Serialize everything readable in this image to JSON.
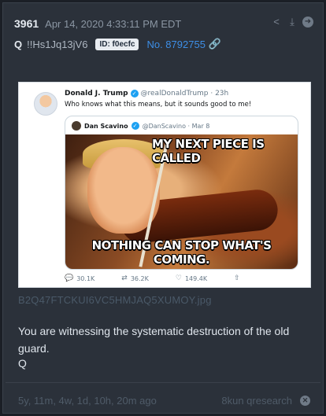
{
  "post": {
    "number": "3961",
    "timestamp": "Apr 14, 2020 4:33:11 PM EDT",
    "author": "Q",
    "tripcode": "!!Hs1Jq13jV6",
    "id_badge": "ID: f0ecfc",
    "post_link": "No. 8792755",
    "icons": [
      "share-icon",
      "download-icon",
      "forward-icon",
      "link-icon"
    ]
  },
  "tweet": {
    "author_name": "Donald J. Trump",
    "author_handle": "@realDonaldTrump · 23h",
    "text": "Who knows what this means, but it sounds good to me!",
    "quote": {
      "author_name": "Dan Scavino",
      "author_handle": "@DanScavino · Mar 8",
      "meme_top": "MY NEXT PIECE IS CALLED",
      "meme_bottom": "NOTHING CAN STOP WHAT'S COMING."
    },
    "stats": {
      "replies": "30.1K",
      "retweets": "36.2K",
      "likes": "149.4K"
    }
  },
  "attachment": {
    "filename": "B2Q47FTCKUI6VC5HMJAQ5XUMOY.jpg"
  },
  "message": {
    "text": "You are witnessing the systematic destruction of the old guard.",
    "signature": "Q"
  },
  "footer": {
    "relative_time": "5y, 11m, 4w, 1d, 10h, 20m ago",
    "source": "8kun qresearch"
  },
  "colors": {
    "background": "#1b1f26",
    "card": "#2b313a",
    "link": "#3d8ee6"
  }
}
